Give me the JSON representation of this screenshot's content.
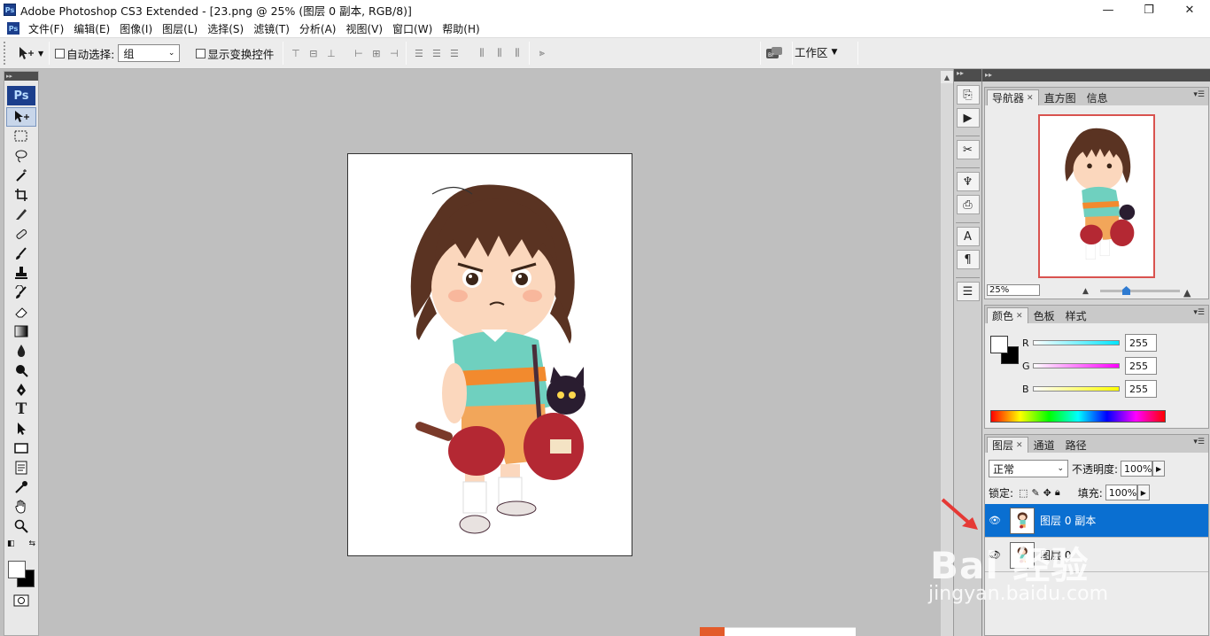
{
  "window": {
    "title": "Adobe Photoshop CS3 Extended - [23.png @ 25% (图层 0 副本, RGB/8)]",
    "ps_badge": "Ps",
    "minimize": "—",
    "restore": "❐",
    "close": "✕"
  },
  "menubar": {
    "items": [
      "文件(F)",
      "编辑(E)",
      "图像(I)",
      "图层(L)",
      "选择(S)",
      "滤镜(T)",
      "分析(A)",
      "视图(V)",
      "窗口(W)",
      "帮助(H)"
    ],
    "doc_controls": [
      "_",
      "❐",
      "✕"
    ]
  },
  "options": {
    "auto_select_label": "自动选择:",
    "auto_select_value": "组",
    "show_transform_label": "显示变换控件",
    "workspace_label": "工作区"
  },
  "toolbox": {
    "logo": "Ps",
    "tools": [
      "move-tool",
      "marquee-tool",
      "lasso-tool",
      "magic-wand-tool",
      "crop-tool",
      "slice-tool",
      "healing-brush-tool",
      "brush-tool",
      "clone-stamp-tool",
      "history-brush-tool",
      "eraser-tool",
      "gradient-tool",
      "blur-tool",
      "dodge-tool",
      "pen-tool",
      "type-tool",
      "path-selection-tool",
      "shape-tool",
      "notes-tool",
      "eyedropper-tool",
      "hand-tool",
      "zoom-tool"
    ]
  },
  "navigator": {
    "tabs": [
      "导航器",
      "直方图",
      "信息"
    ],
    "zoom": "25%"
  },
  "color_panel": {
    "tabs": [
      "颜色",
      "色板",
      "样式"
    ],
    "channels": [
      {
        "label": "R",
        "value": "255",
        "ramp": "#00e5ff"
      },
      {
        "label": "G",
        "value": "255",
        "ramp": "#ff00ff"
      },
      {
        "label": "B",
        "value": "255",
        "ramp": "#ffff00"
      }
    ]
  },
  "layers_panel": {
    "tabs": [
      "图层",
      "通道",
      "路径"
    ],
    "blend_mode": "正常",
    "opacity_label": "不透明度:",
    "opacity_value": "100%",
    "lock_label": "锁定:",
    "fill_label": "填充:",
    "fill_value": "100%",
    "layers": [
      {
        "name": "图层 0 副本",
        "selected": true
      },
      {
        "name": "图层 0",
        "selected": false
      }
    ]
  },
  "watermark": {
    "text": "Bai 经验",
    "url": "jingyan.baidu.com"
  },
  "colors": {
    "selection": "#0a6fd1",
    "annotation": "#e53935",
    "ps_blue": "#1c3f8c"
  }
}
